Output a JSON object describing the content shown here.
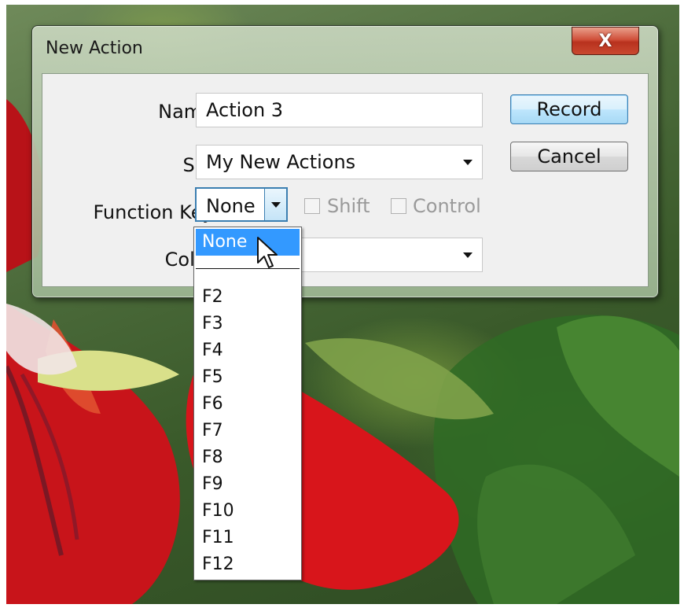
{
  "window": {
    "title": "New Action",
    "close_label": "X"
  },
  "form": {
    "name_label": "Name:",
    "name_value": "Action 3",
    "set_label": "Set:",
    "set_value": "My New Actions",
    "function_key_label": "Function Key:",
    "function_key_value": "None",
    "shift_label": "Shift",
    "control_label": "Control",
    "color_label": "Color:",
    "color_value": ""
  },
  "buttons": {
    "record": "Record",
    "cancel": "Cancel"
  },
  "function_key_options": {
    "selected": "None",
    "items": [
      "F2",
      "F3",
      "F4",
      "F5",
      "F6",
      "F7",
      "F8",
      "F9",
      "F10",
      "F11",
      "F12"
    ]
  },
  "colors": {
    "selection": "#3399ff",
    "default_button_border": "#3c7fb1",
    "close_button": "#c9482f"
  }
}
